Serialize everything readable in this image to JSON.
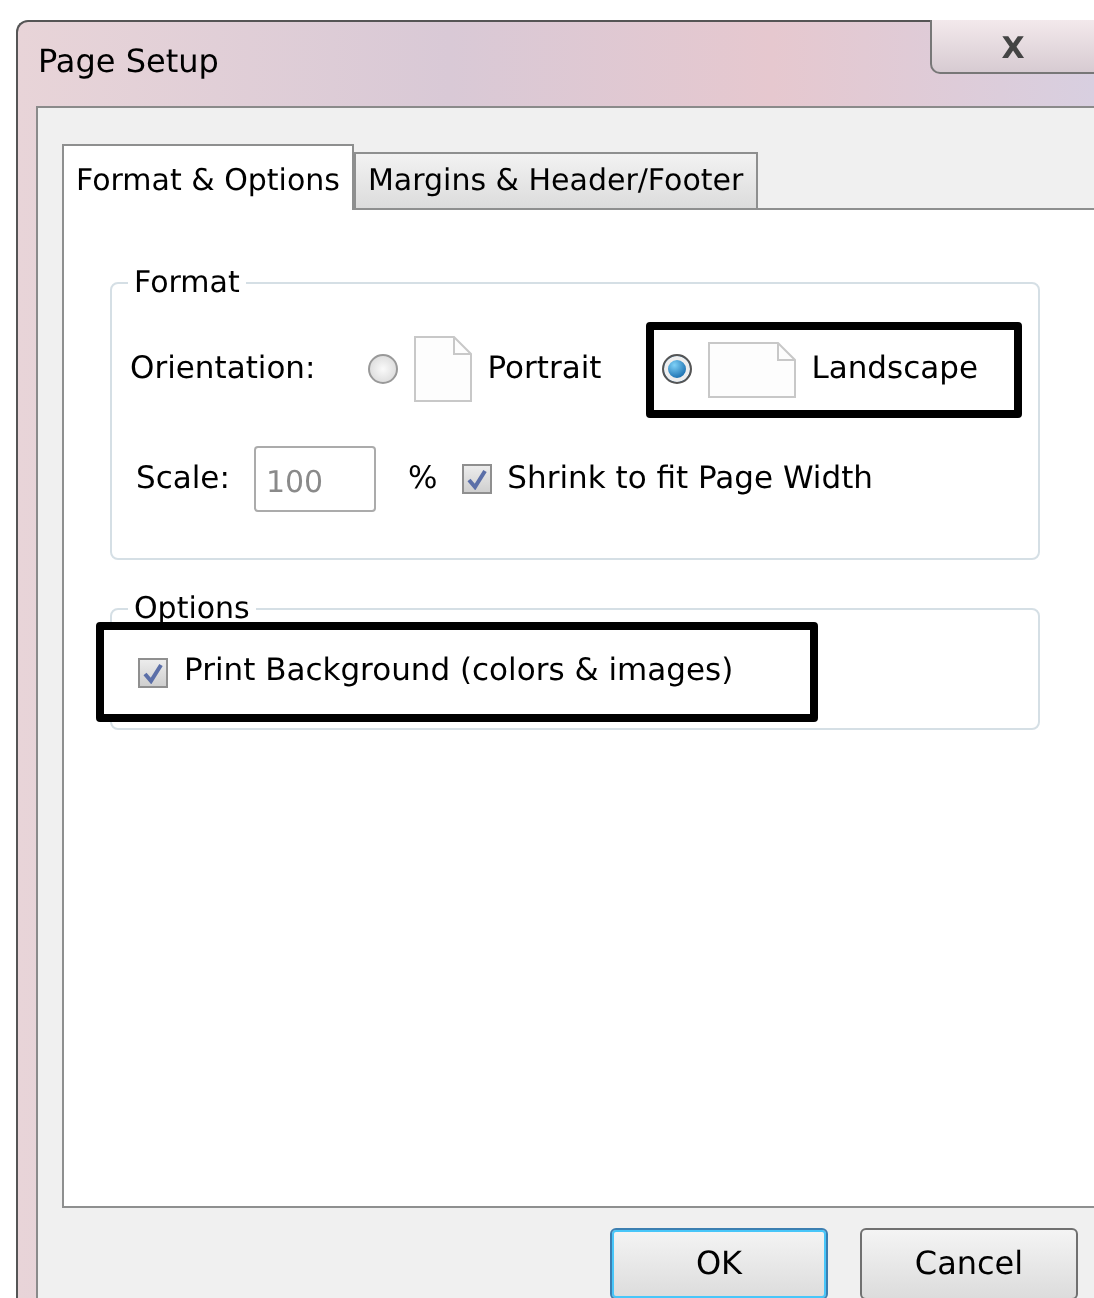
{
  "window": {
    "title": "Page Setup",
    "close": "X"
  },
  "tabs": [
    {
      "label": "Format & Options",
      "selected": true
    },
    {
      "label": "Margins & Header/Footer",
      "selected": false
    }
  ],
  "format": {
    "legend": "Format",
    "orientation_label": "Orientation:",
    "orientations": [
      {
        "label": "Portrait",
        "kind": "portrait",
        "selected": false,
        "highlighted": false
      },
      {
        "label": "Landscape",
        "kind": "landscape",
        "selected": true,
        "highlighted": true
      }
    ],
    "scale_label": "Scale:",
    "scale_value": "100",
    "scale_unit": "%",
    "shrink": {
      "label": "Shrink to fit Page Width",
      "checked": true
    }
  },
  "options": {
    "legend": "Options",
    "items": [
      {
        "label": "Print Background (colors & images)",
        "checked": true,
        "highlighted": true
      }
    ]
  },
  "buttons": [
    {
      "label": "OK",
      "default": true
    },
    {
      "label": "Cancel",
      "default": false
    }
  ]
}
